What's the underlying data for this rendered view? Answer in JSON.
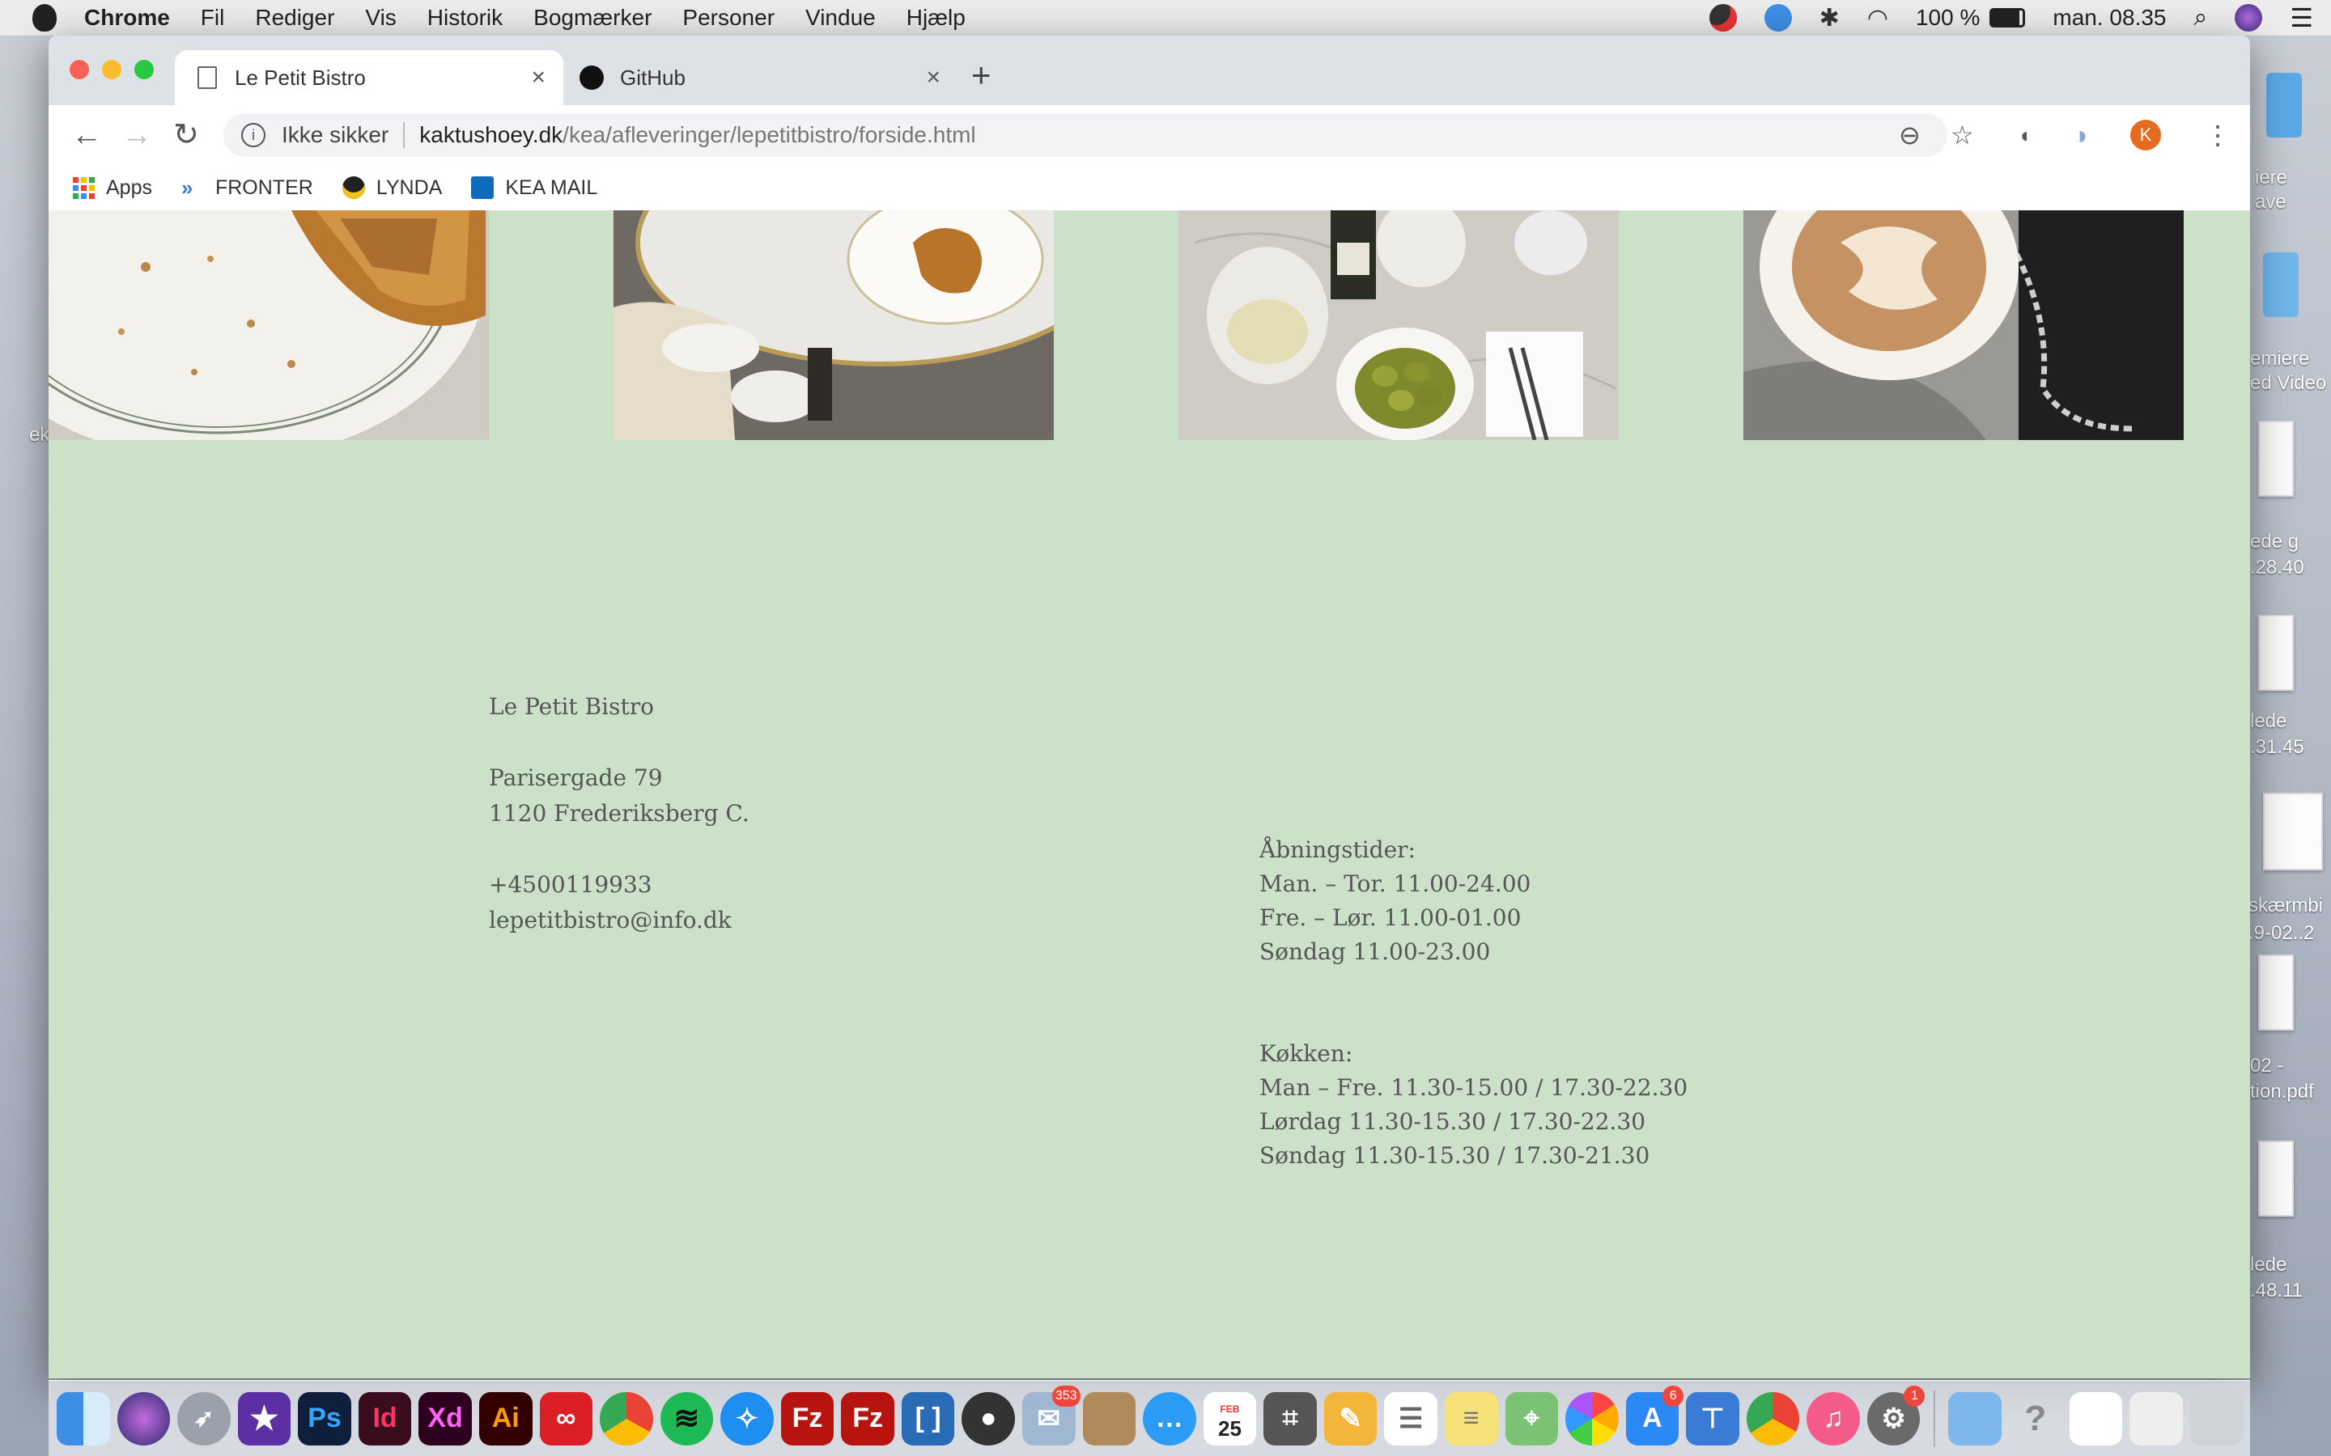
{
  "menubar": {
    "app_name": "Chrome",
    "items": [
      "Fil",
      "Rediger",
      "Vis",
      "Historik",
      "Bogmærker",
      "Personer",
      "Vindue",
      "Hjælp"
    ],
    "battery": "100 %",
    "clock": "man. 08.35"
  },
  "tabs": [
    {
      "title": "Le Petit Bistro",
      "close": "×"
    },
    {
      "title": "GitHub",
      "close": "×"
    }
  ],
  "toolbar": {
    "security_label": "Ikke sikker",
    "url_host": "kaktushoey.dk",
    "url_path": "/kea/afleveringer/lepetitbistro/forside.html",
    "profile_initial": "K"
  },
  "bookmarks": [
    {
      "label": "Apps"
    },
    {
      "label": "FRONTER"
    },
    {
      "label": "LYNDA"
    },
    {
      "label": "KEA MAIL"
    }
  ],
  "page": {
    "photos": [
      "croissant-plate",
      "sneakers-croissant-table",
      "wine-olives-table",
      "latte-handbag"
    ],
    "contact": {
      "name": "Le Petit Bistro",
      "street": "Parisergade 79",
      "city": "1120 Frederiksberg C.",
      "phone": "+4500119933",
      "email": "lepetitbistro@info.dk"
    },
    "opening_hours": {
      "title": "Åbningstider:",
      "lines": [
        "Man. – Tor. 11.00-24.00",
        "Fre. – Lør. 11.00-01.00",
        "Søndag 11.00-23.00"
      ]
    },
    "kitchen": {
      "title": "Køkken:",
      "lines": [
        "Man – Fre. 11.30-15.00 / 17.30-22.30",
        "Lørdag 11.30-15.30 / 17.30-22.30",
        "Søndag 11.30-15.30 / 17.30-21.30"
      ]
    }
  },
  "desktop_labels": [
    "iere",
    "ave",
    "emiere",
    "ed Video",
    "ede g",
    ".28.40",
    "lede",
    ".31.45",
    "skærmbi",
    ".9-02..2",
    "02 -",
    "tion.pdf",
    "lede",
    ".48.11",
    "ek"
  ],
  "dock": {
    "badges": {
      "mail": "353",
      "calendar_month": "FEB",
      "calendar_day": "25",
      "appstore": "6",
      "settings": "1"
    }
  }
}
